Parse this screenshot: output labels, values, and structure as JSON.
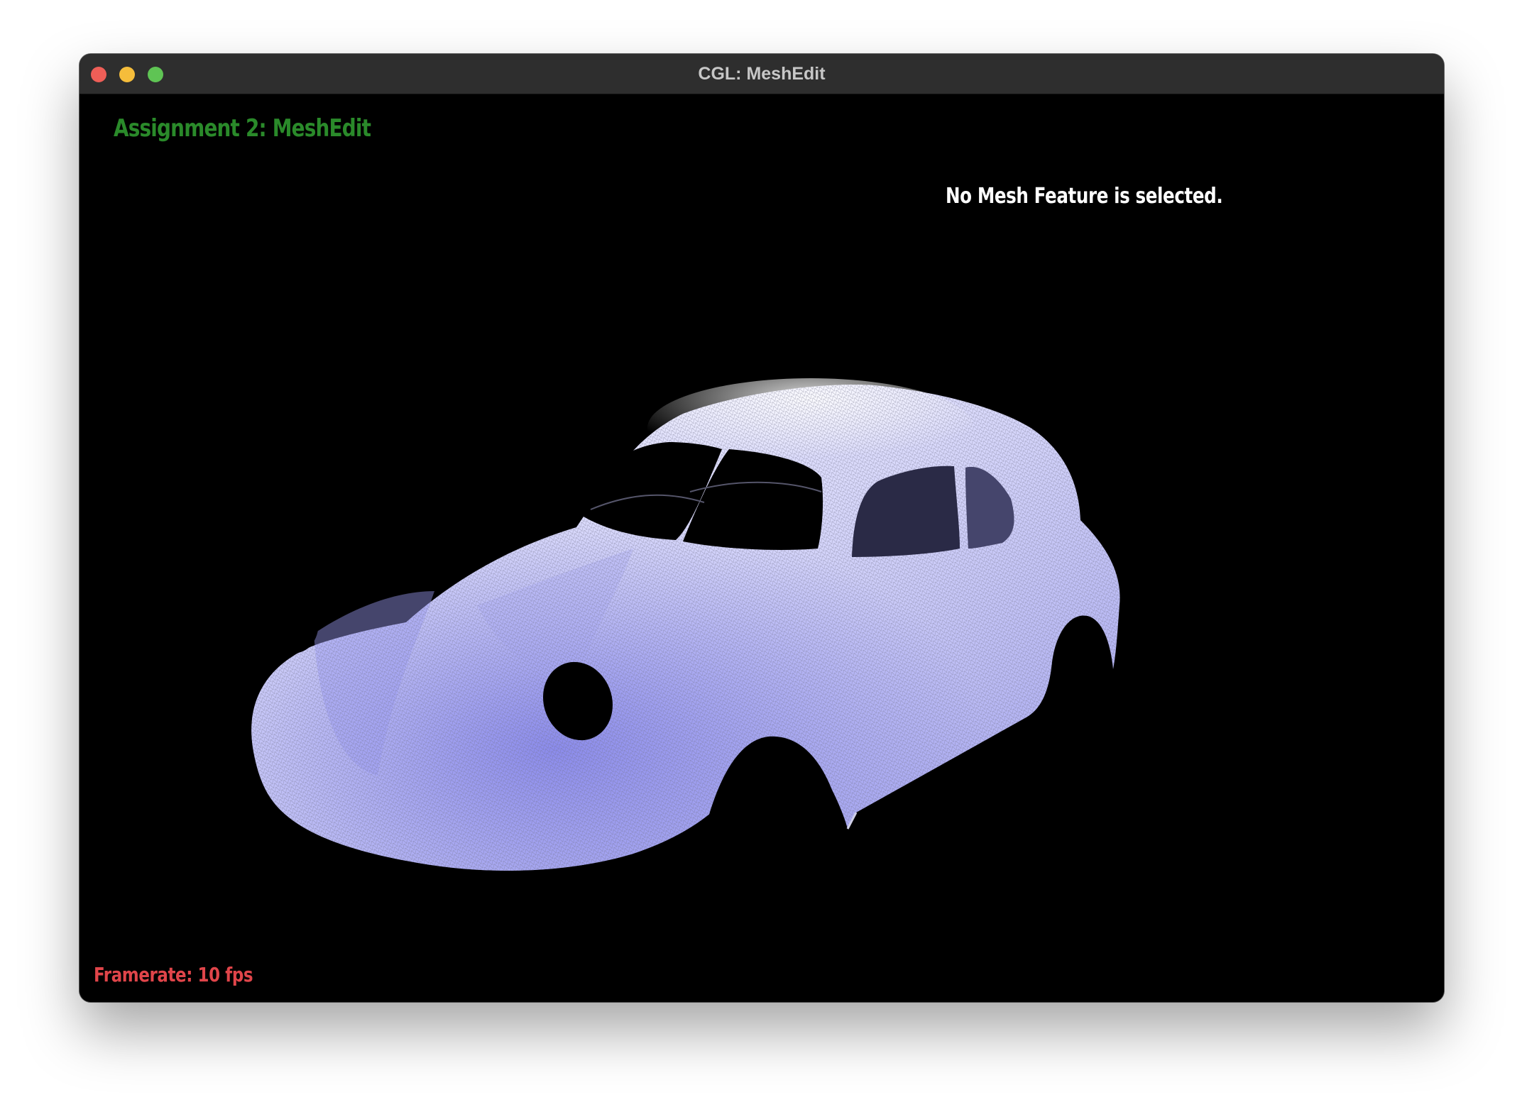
{
  "window": {
    "title": "CGL: MeshEdit",
    "controls": [
      "close-button",
      "minimize-button",
      "maximize-button"
    ]
  },
  "viewport": {
    "title": "Assignment 2: MeshEdit",
    "status": "No Mesh Feature is selected.",
    "framerate": "Framerate: 10 fps"
  },
  "colors": {
    "title_green": "#2a8a2a",
    "status_white": "#ffffff",
    "framerate_red": "#e0454a",
    "mesh_light": "#eeeeff",
    "mesh_shadow": "#8e8ef0",
    "background": "#000000"
  },
  "scene": {
    "model": "car-body-mesh",
    "render_mode": "wireframe-over-shaded"
  }
}
